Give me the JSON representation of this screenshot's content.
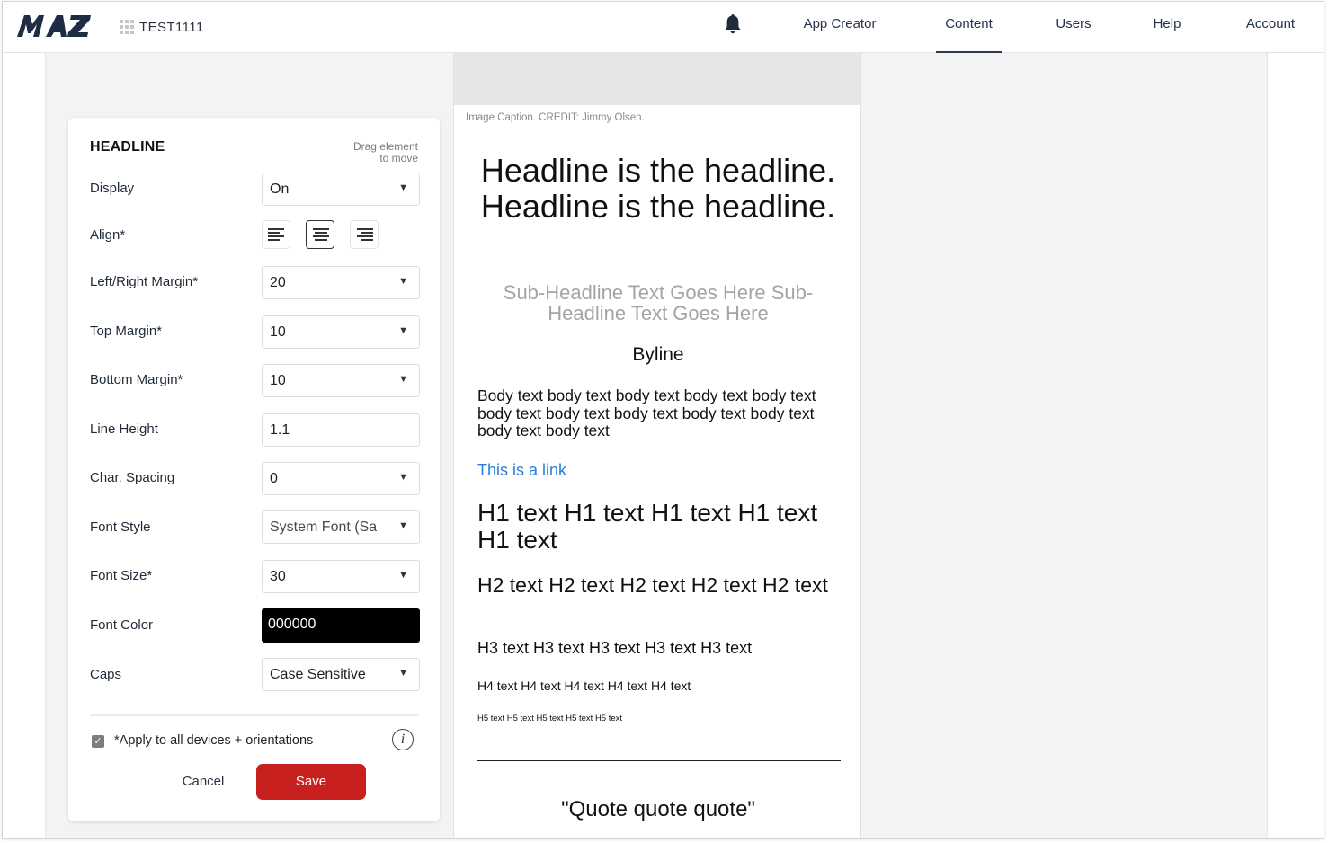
{
  "app": {
    "logo_text": "MAZ",
    "project_name": "TEST1111"
  },
  "nav": {
    "items": [
      {
        "label": "App Creator"
      },
      {
        "label": "Content",
        "active": true
      },
      {
        "label": "Users"
      },
      {
        "label": "Help"
      },
      {
        "label": "Account"
      }
    ],
    "icons": [
      "grid-apps-icon",
      "bell-icon"
    ]
  },
  "panel": {
    "title": "HEADLINE",
    "drag_hint_line1": "Drag element",
    "drag_hint_line2": "to move",
    "fields": {
      "display": {
        "label": "Display",
        "value": "On"
      },
      "align": {
        "label": "Align*",
        "options": [
          "left",
          "center",
          "right"
        ],
        "selected": "center"
      },
      "left_right_margin": {
        "label": "Left/Right Margin*",
        "value": "20"
      },
      "top_margin": {
        "label": "Top Margin*",
        "value": "10"
      },
      "bottom_margin": {
        "label": "Bottom Margin*",
        "value": "10"
      },
      "line_height": {
        "label": "Line Height",
        "value": "1.1"
      },
      "char_spacing": {
        "label": "Char. Spacing",
        "value": "0"
      },
      "font_style": {
        "label": "Font Style",
        "value": "System Font (Sa"
      },
      "font_size": {
        "label": "Font Size*",
        "value": "30"
      },
      "font_color": {
        "label": "Font Color",
        "value": "000000"
      },
      "caps": {
        "label": "Caps",
        "value": "Case Sensitive"
      }
    },
    "apply_all": {
      "label": "*Apply to all devices + orientations",
      "checked": true
    },
    "cancel_label": "Cancel",
    "save_label": "Save"
  },
  "preview": {
    "caption": "Image Caption. CREDIT: Jimmy Olsen.",
    "headline": "Headline is the headline. Headline is the headline.",
    "subheadline": "Sub-Headline Text Goes Here Sub-Headline Text Goes Here",
    "byline": "Byline",
    "body": "Body text body text body text body text body text body text body text body text body text body text body text body text",
    "link": "This is a link",
    "h1": "H1 text H1 text H1 text H1 text H1 text",
    "h2": "H2 text H2 text H2 text H2 text H2 text",
    "h3": "H3 text H3 text H3 text H3 text H3 text",
    "h4": "H4 text H4 text H4 text H4 text H4 text",
    "h5": "H5 text H5 text H5 text H5 text H5 text",
    "quote": "\"Quote quote quote\""
  },
  "colors": {
    "brand_navy": "#1e2c44",
    "save_red": "#c7201f",
    "link_blue": "#2b7fd8",
    "font_color_swatch": "#000000"
  }
}
